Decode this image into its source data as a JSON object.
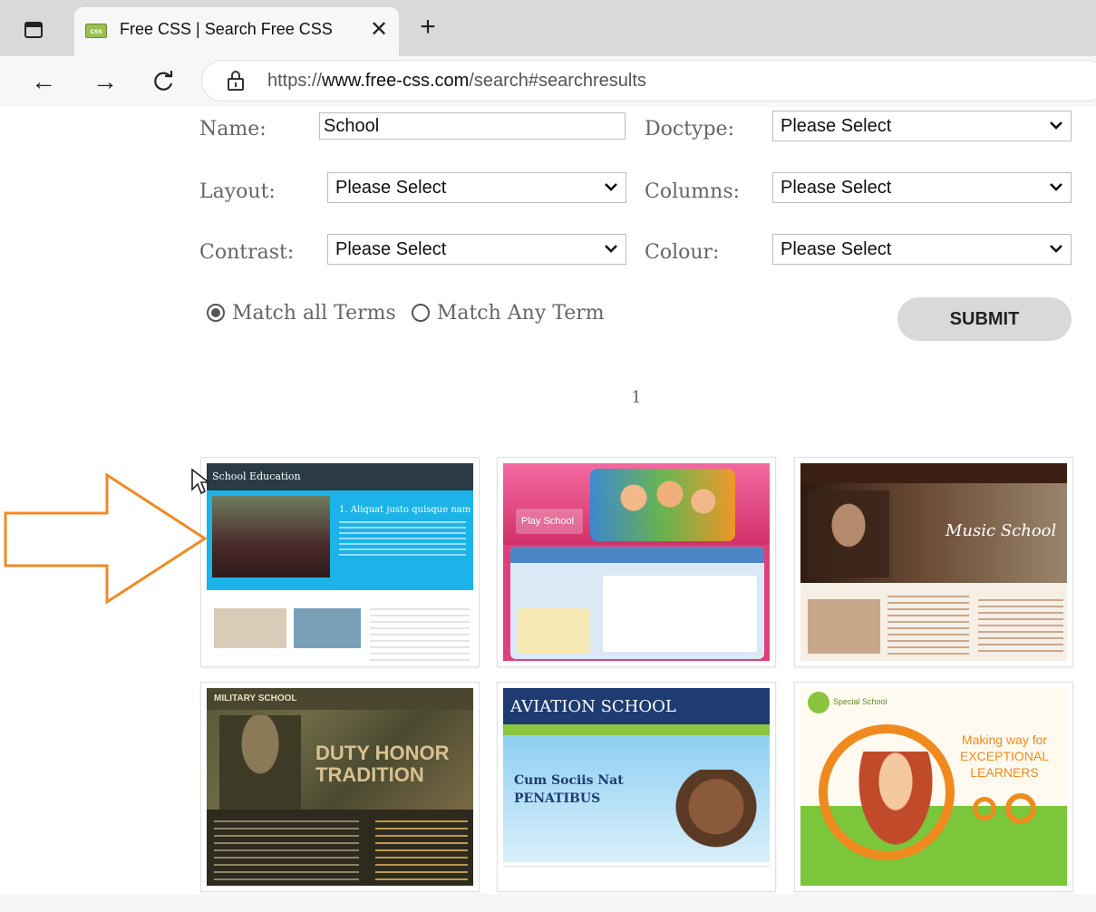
{
  "browser": {
    "tab_title": "Free CSS | Search Free CSS",
    "favicon_text": "css",
    "url_prefix": "https://",
    "url_host": "www.free-css.com",
    "url_path": "/search#searchresults"
  },
  "form": {
    "name_label": "Name:",
    "name_value": "School",
    "doctype_label": "Doctype:",
    "doctype_value": "Please Select",
    "layout_label": "Layout:",
    "layout_value": "Please Select",
    "columns_label": "Columns:",
    "columns_value": "Please Select",
    "contrast_label": "Contrast:",
    "contrast_value": "Please Select",
    "colour_label": "Colour:",
    "colour_value": "Please Select",
    "match_all_label": "Match all Terms",
    "match_any_label": "Match Any Term",
    "submit_label": "SUBMIT"
  },
  "pagination": {
    "page": "1"
  },
  "templates": [
    {
      "heading": "School Education",
      "subheading": "1. Aliquat justo quisque nam"
    },
    {
      "heading": "Play School"
    },
    {
      "heading": "Music School"
    },
    {
      "heading": "MILITARY SCHOOL",
      "subheading": "DUTY HONOR TRADITION"
    },
    {
      "heading": "AVIATION SCHOOL",
      "subheading": "Cum Sociis Nat PENATIBUS"
    },
    {
      "heading": "Special School",
      "subheading": "Making way for EXCEPTIONAL LEARNERS"
    }
  ],
  "colors": {
    "annotation_arrow": "#f08a24"
  }
}
